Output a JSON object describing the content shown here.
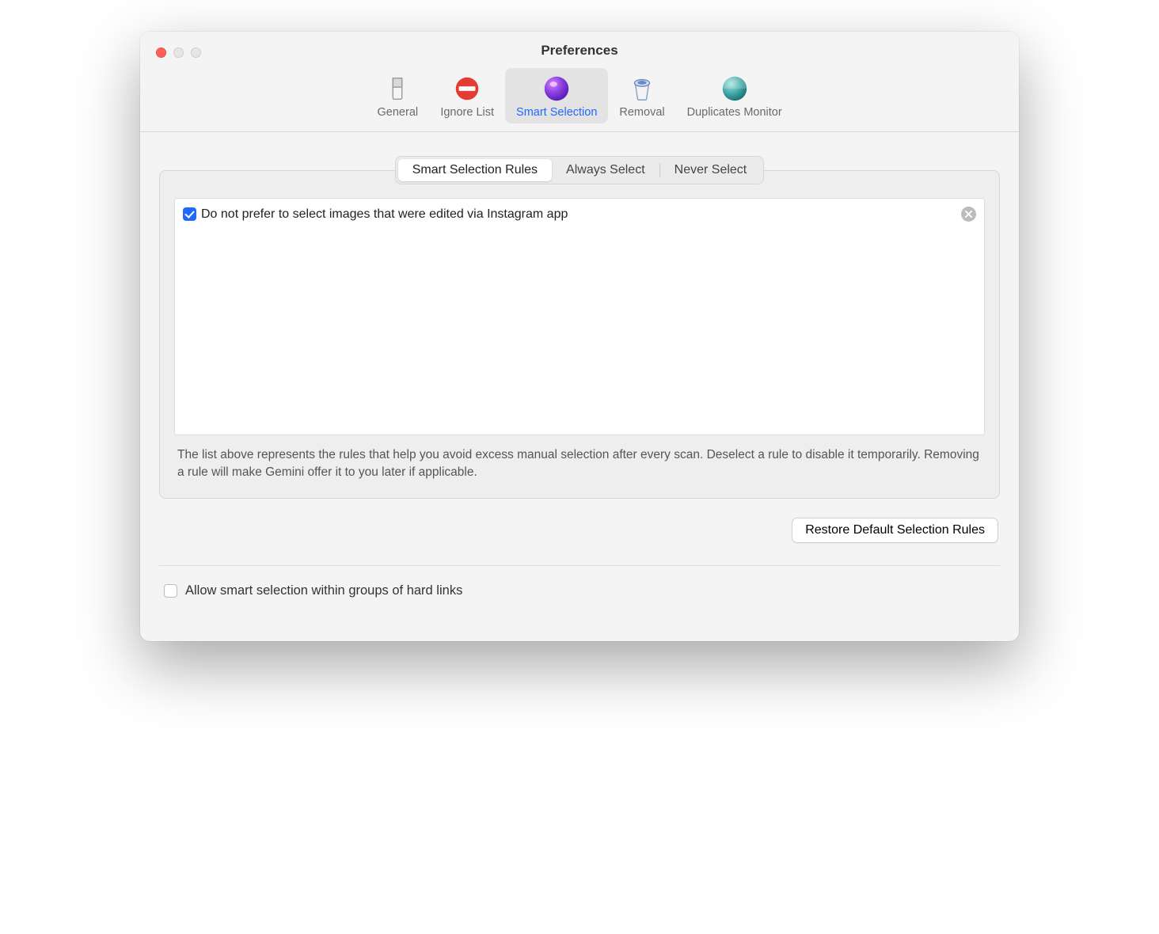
{
  "window": {
    "title": "Preferences"
  },
  "toolbar": {
    "items": [
      {
        "label": "General"
      },
      {
        "label": "Ignore List"
      },
      {
        "label": "Smart Selection"
      },
      {
        "label": "Removal"
      },
      {
        "label": "Duplicates Monitor"
      }
    ]
  },
  "segmented": {
    "tabs": [
      {
        "label": "Smart Selection Rules"
      },
      {
        "label": "Always Select"
      },
      {
        "label": "Never Select"
      }
    ]
  },
  "rules": [
    {
      "checked": true,
      "text": "Do not prefer to select images that were edited via Instagram app"
    }
  ],
  "help_text": "The list above represents the rules that help you avoid excess manual selection after every scan. Deselect a rule to disable it temporarily. Removing a rule will make Gemini offer it to you later if applicable.",
  "buttons": {
    "restore": "Restore Default Selection Rules"
  },
  "footer": {
    "hardlinks_label": "Allow smart selection within groups of hard links",
    "hardlinks_checked": false
  }
}
